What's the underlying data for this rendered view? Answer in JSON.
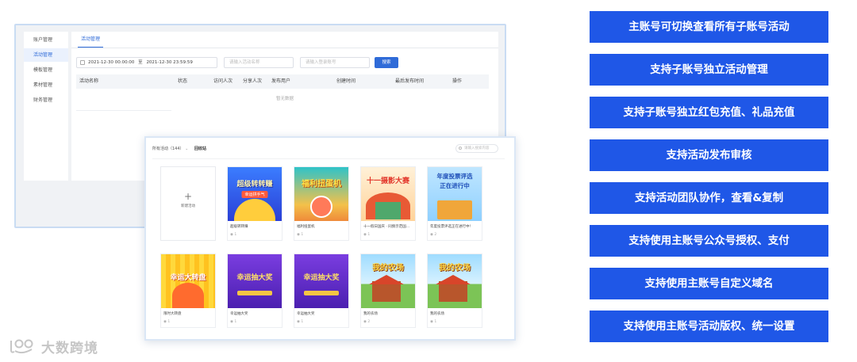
{
  "admin": {
    "sidebar": [
      "账户管理",
      "活动管理",
      "模板管理",
      "素材管理",
      "财务管理"
    ],
    "active_sidebar_index": 1,
    "tab": "活动管理",
    "date_start": "2021-12-30 00:00:00",
    "date_sep": "至",
    "date_end": "2021-12-30 23:59:59",
    "activity_name_placeholder": "请输入活动名称",
    "account_placeholder": "请输入登录账号",
    "search_button": "搜索",
    "columns": [
      "活动名称",
      "状态",
      "访问人次",
      "分享人次",
      "发布用户",
      "创建时间",
      "最后发布时间",
      "操作"
    ],
    "empty_text": "暂无数据"
  },
  "activities": {
    "filter_label": "所有活动（144）",
    "recycle_label": "回收站",
    "search_placeholder": "请输入搜索内容",
    "new_activity": "新建活动",
    "cards": [
      {
        "name": "超级转转赚",
        "views": "1",
        "poster": "超级转转赚",
        "poster_sub": "幸运拼手气",
        "theme": "blue"
      },
      {
        "name": "福利扭蛋机",
        "views": "1",
        "poster": "福利扭蛋机",
        "poster_sub": "",
        "theme": "teal"
      },
      {
        "name": "十一假日国庆 · 同频示范国...",
        "views": "1",
        "poster": "十一摄影大赛",
        "poster_sub": "",
        "theme": "orange"
      },
      {
        "name": "年度投票评选正在进行中!",
        "views": "2",
        "poster": "年度投票评选",
        "poster_sub": "正在进行中",
        "theme": "sky"
      },
      {
        "name": "限时大转盘",
        "views": "1",
        "poster": "幸运大转盘",
        "poster_sub": "",
        "theme": "yellow"
      },
      {
        "name": "幸运抽大奖",
        "views": "1",
        "poster": "幸运抽大奖",
        "poster_sub": "",
        "theme": "purple"
      },
      {
        "name": "幸运抽大奖",
        "views": "1",
        "poster": "幸运抽大奖",
        "poster_sub": "",
        "theme": "purple"
      },
      {
        "name": "我的农场",
        "views": "2",
        "poster": "我的农场",
        "poster_sub": "",
        "theme": "farm"
      },
      {
        "name": "我的农场",
        "views": "1",
        "poster": "我的农场",
        "poster_sub": "",
        "theme": "farm"
      }
    ]
  },
  "features": [
    "主账号可切换查看所有子账号活动",
    "支持子账号独立活动管理",
    "支持子账号独立红包充值、礼品充值",
    "支持活动发布审核",
    "支持活动团队协作，查看&复制",
    "支持使用主账号公众号授权、支付",
    "支持使用主账号自定义域名",
    "支持使用主账号活动版权、统一设置"
  ],
  "watermark": "大数跨境",
  "colors": {
    "accent": "#1f57e7",
    "link": "#2f6bd8"
  }
}
